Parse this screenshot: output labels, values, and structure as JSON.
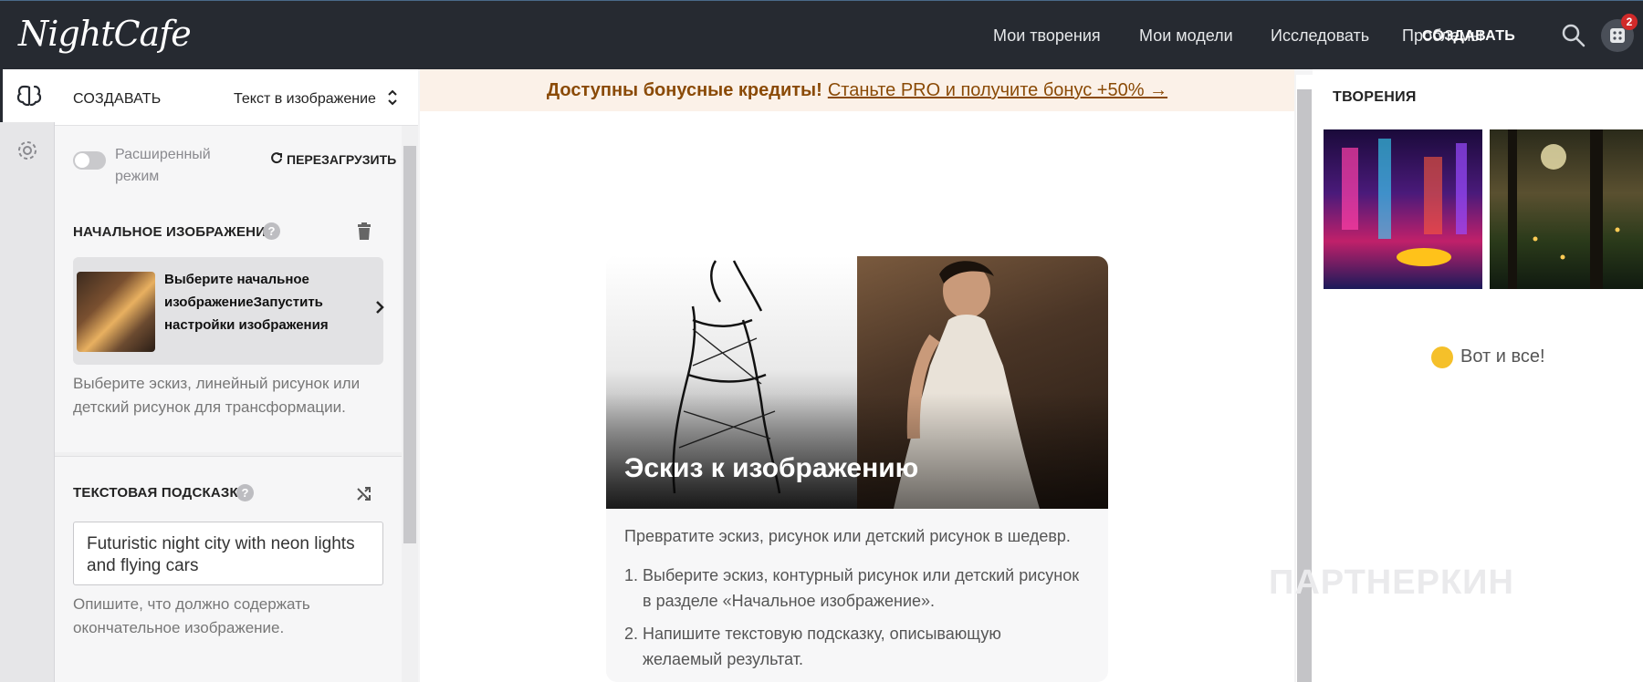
{
  "app": {
    "logo": "NightCafe"
  },
  "topnav": {
    "items": [
      "Мои творения",
      "Мои модели",
      "Исследовать",
      "Проблемы"
    ],
    "create_label": "СОЗДАВАТЬ",
    "badge_count": "2"
  },
  "panel": {
    "title": "СОЗДАВАТЬ",
    "mode": "Текст в изображение",
    "advanced_label": "Расширенный режим",
    "advanced_on": false,
    "reload_label": "ПЕРЕЗАГРУЗИТЬ",
    "initial_image": {
      "label": "НАЧАЛЬНОЕ ИЗОБРАЖЕНИЕ",
      "card_text": "Выберите начальное изображениеЗапустить настройки изображения",
      "hint": "Выберите эскиз, линейный рисунок или детский рисунок для трансформации."
    },
    "prompt": {
      "label": "ТЕКСТОВАЯ ПОДСКАЗКА",
      "value": "Futuristic night city with neon lights and flying cars",
      "hint": "Опишите, что должно содержать окончательное изображение."
    }
  },
  "banner": {
    "strong": "Доступны бонусные кредиты!",
    "link": "Станьте PRO и получите бонус +50% →"
  },
  "card": {
    "title": "Эскиз к изображению",
    "description": "Превратите эскиз, рисунок или детский рисунок в шедевр.",
    "steps": [
      "Выберите эскиз, контурный рисунок или детский рисунок в разделе «Начальное изображение».",
      "Напишите текстовую подсказку, описывающую желаемый результат."
    ]
  },
  "right": {
    "title": "ТВОРЕНИЯ",
    "done": "Вот и все!"
  },
  "watermark": "ПАРТНЕРКИН",
  "colors": {
    "topbar": "#262a31",
    "banner_text": "#8a4a06",
    "badge": "#d12a2a"
  }
}
